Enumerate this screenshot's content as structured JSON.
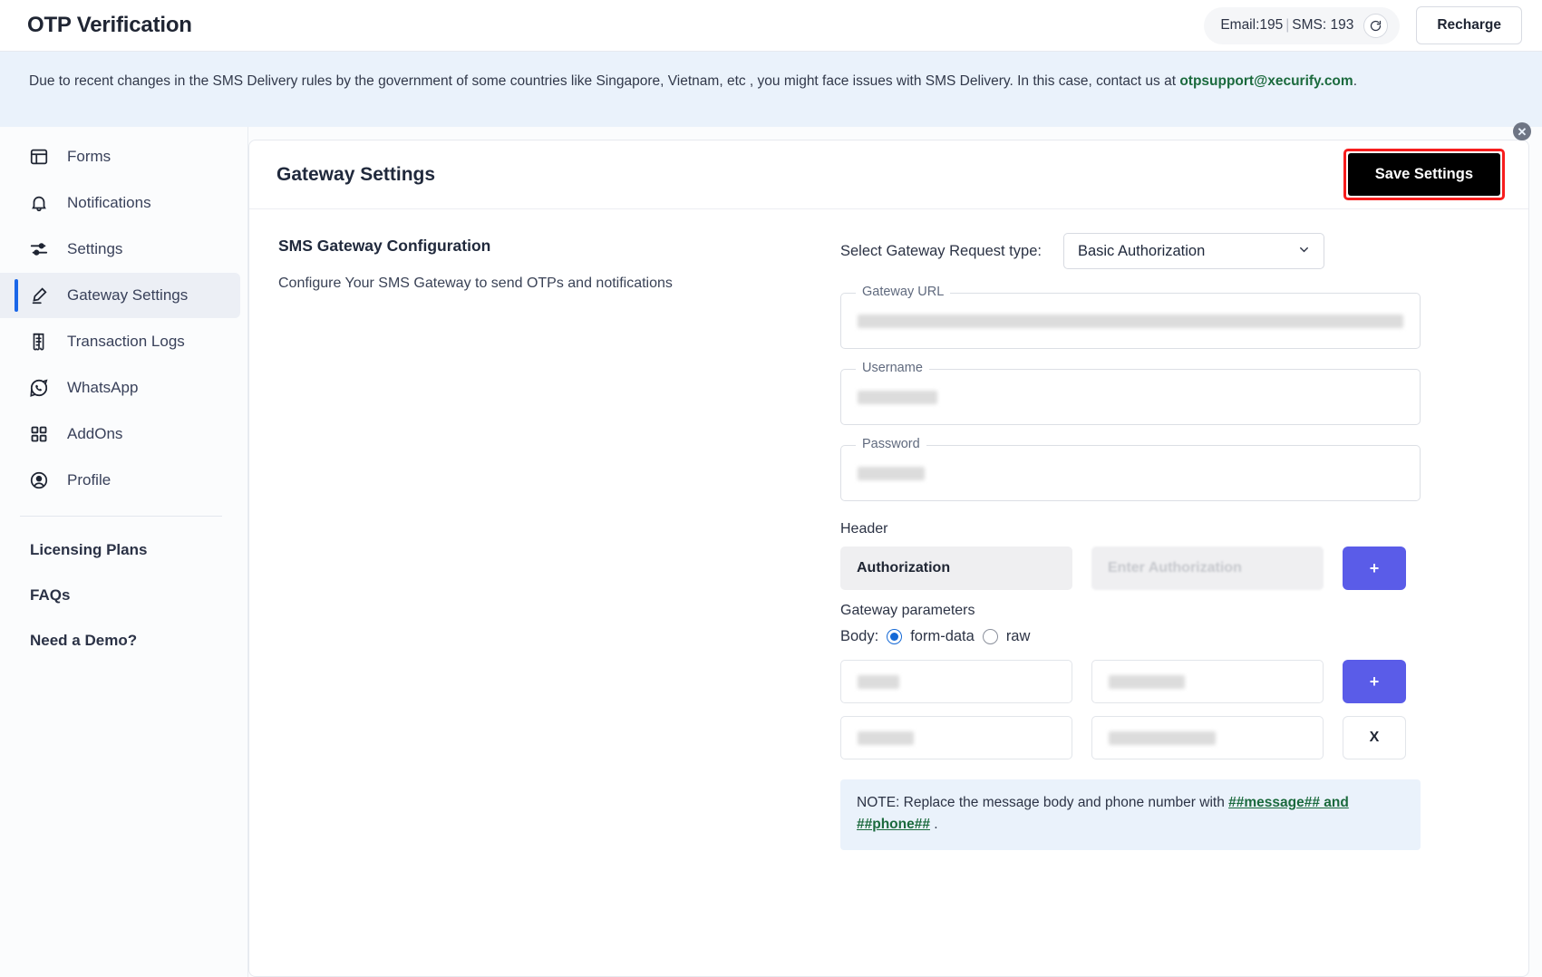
{
  "topbar": {
    "app_title": "OTP Verification",
    "credits_email": "Email:195",
    "credits_separator": "|",
    "credits_sms": "SMS: 193",
    "refresh_icon": "refresh-icon",
    "recharge_label": "Recharge"
  },
  "alert": {
    "text": "Due to recent changes in the SMS Delivery rules by the government of some countries like Singapore, Vietnam, etc , you might face issues with SMS Delivery. In this case, contact us at ",
    "link": "otpsupport@xecurify.com",
    "period": ".",
    "close_icon": "close-icon"
  },
  "sidebar": {
    "items": [
      {
        "label": "Forms",
        "icon": "forms-icon",
        "active": false
      },
      {
        "label": "Notifications",
        "icon": "bell-icon",
        "active": false
      },
      {
        "label": "Settings",
        "icon": "sliders-icon",
        "active": false
      },
      {
        "label": "Gateway Settings",
        "icon": "pen-icon",
        "active": true
      },
      {
        "label": "Transaction Logs",
        "icon": "receipt-icon",
        "active": false
      },
      {
        "label": "WhatsApp",
        "icon": "whatsapp-icon",
        "active": false
      },
      {
        "label": "AddOns",
        "icon": "grid-icon",
        "active": false
      },
      {
        "label": "Profile",
        "icon": "user-circle-icon",
        "active": false
      }
    ],
    "plain_links": [
      {
        "label": "Licensing Plans"
      },
      {
        "label": "FAQs"
      },
      {
        "label": "Need a Demo?"
      }
    ]
  },
  "main": {
    "page_title": "Gateway Settings",
    "save_label": "Save Settings",
    "save_highlight_color": "#f71d1d",
    "section_title": "SMS Gateway Configuration",
    "section_subtitle": "Configure Your SMS Gateway to send OTPs and notifications",
    "request_type_label": "Select Gateway Request type:",
    "request_type_value": "Basic Authorization",
    "request_type_options": [
      "Basic Authorization"
    ],
    "fields": [
      {
        "label": "Gateway URL",
        "value": "",
        "redacted": true,
        "redact_class": "url"
      },
      {
        "label": "Username",
        "value": "",
        "redacted": true,
        "redact_class": "user"
      },
      {
        "label": "Password",
        "value": "",
        "redacted": true,
        "redact_class": "pass"
      }
    ],
    "header_group_label": "Header",
    "header_key": "Authorization",
    "header_value_placeholder": "Enter Authorization",
    "header_add_label": "+",
    "params_group_label": "Gateway parameters",
    "body_label": "Body:",
    "body_option_formdata": "form-data",
    "body_option_raw": "raw",
    "body_selected": "form-data",
    "param_add_label": "+",
    "param_delete_label": "X",
    "note_prefix": "NOTE: Replace the message body and phone number with ",
    "note_token_1": "##message## and ##phone##",
    "note_suffix": " ."
  },
  "colors": {
    "accent_purple": "#5a5ce8",
    "active_blue": "#1a66e8",
    "alert_bg": "#eaf2fb",
    "link_green": "#1b6a3d",
    "save_bg": "#000000"
  }
}
